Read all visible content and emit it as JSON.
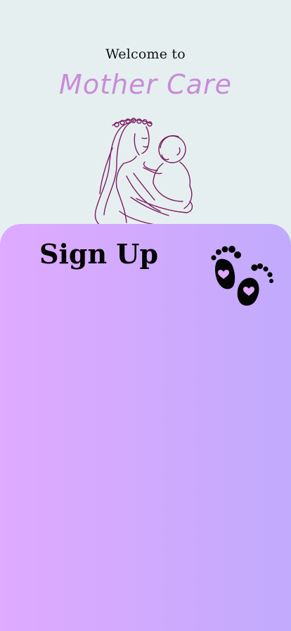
{
  "header": {
    "welcome_text": "Welcome to",
    "brand_name": "Mother Care"
  },
  "illustration": {
    "icon": "mother-holding-baby-illustration",
    "line_color": "#7d1c62"
  },
  "signup_sheet": {
    "title": "Sign Up",
    "icon": "baby-feet-icon",
    "gradient_start": "#dfaaff",
    "gradient_end": "#c2aafc"
  },
  "colors": {
    "background": "#e6eff0",
    "brand": "#c98bd8",
    "text": "#111111"
  }
}
